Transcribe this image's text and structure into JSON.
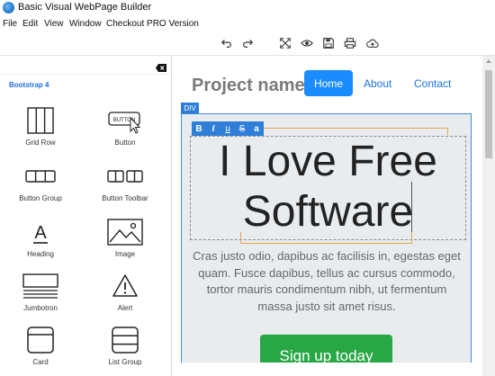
{
  "window": {
    "title": "Basic Visual WebPage Builder",
    "icon": "globe-app-icon"
  },
  "menu": {
    "items": [
      "File",
      "Edit",
      "View",
      "Window",
      "Checkout PRO Version"
    ]
  },
  "toolbar": {
    "buttons": [
      {
        "name": "undo",
        "icon": "undo-icon"
      },
      {
        "name": "redo",
        "icon": "redo-icon"
      },
      {
        "name": "fullscreen",
        "icon": "fullscreen-icon"
      },
      {
        "name": "preview",
        "icon": "eye-icon"
      },
      {
        "name": "save",
        "icon": "save-icon"
      },
      {
        "name": "print",
        "icon": "print-icon"
      },
      {
        "name": "upload",
        "icon": "cloud-upload-icon"
      }
    ]
  },
  "left_panel": {
    "group_title": "Bootstrap 4",
    "close_icon": "backspace-close-icon",
    "components": [
      {
        "label": "Grid Row",
        "icon": "grid-row-icon"
      },
      {
        "label": "Button",
        "icon": "button-icon",
        "icon_text": "BUTTON"
      },
      {
        "label": "Button Group",
        "icon": "button-group-icon"
      },
      {
        "label": "Button Toolbar",
        "icon": "button-toolbar-icon"
      },
      {
        "label": "Heading",
        "icon": "heading-icon",
        "icon_text": "A"
      },
      {
        "label": "Image",
        "icon": "image-icon"
      },
      {
        "label": "Jumbotron",
        "icon": "jumbotron-icon"
      },
      {
        "label": "Alert",
        "icon": "alert-icon"
      },
      {
        "label": "Card",
        "icon": "card-icon"
      },
      {
        "label": "List Group",
        "icon": "list-group-icon"
      }
    ]
  },
  "canvas": {
    "brand": "Project name",
    "nav": {
      "active": "Home",
      "links": [
        "About",
        "Contact"
      ]
    },
    "selection_tag": "DIV",
    "format_buttons": [
      "B",
      "I",
      "u",
      "S",
      "a"
    ],
    "heading": "I Love Free Software",
    "lead": "Cras justo odio, dapibus ac facilisis in, egestas eget quam. Fusce dapibus, tellus ac cursus commodo, tortor mauris condimentum nibh, ut fermentum massa justo sit amet risus.",
    "cta": "Sign up today"
  },
  "colors": {
    "accent": "#1a8cff",
    "selection": "#2f7fd8",
    "cta": "#28a745",
    "guide": "#e6a84a"
  }
}
